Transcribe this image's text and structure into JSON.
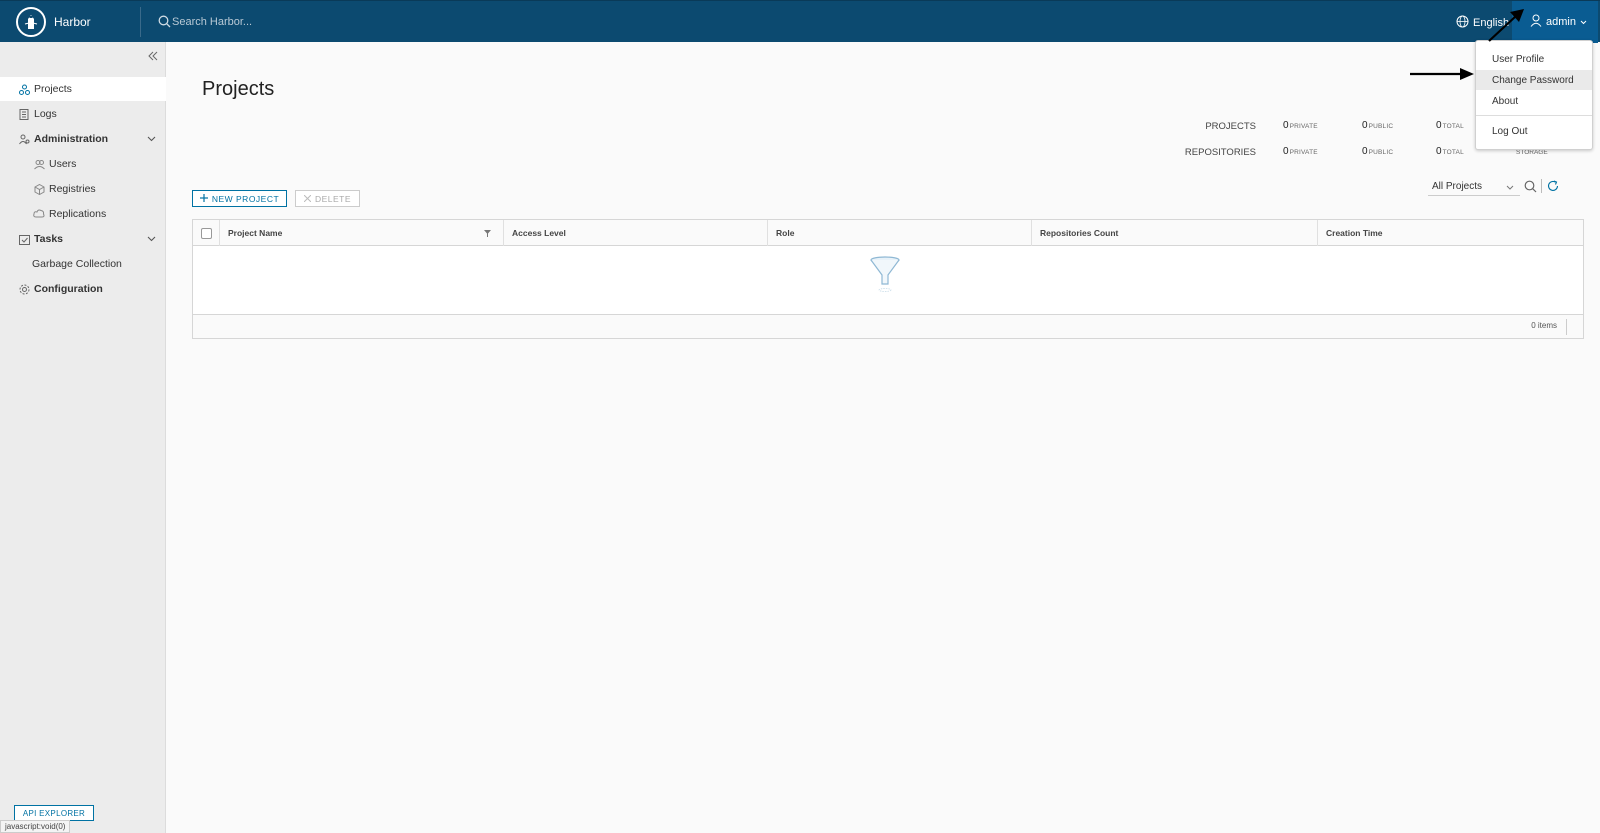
{
  "header": {
    "brand": "Harbor",
    "search_placeholder": "Search Harbor...",
    "language": "English",
    "user": "admin"
  },
  "sidebar": {
    "items": [
      {
        "label": "Projects",
        "icon": "projects-icon"
      },
      {
        "label": "Logs",
        "icon": "logs-icon"
      },
      {
        "label": "Administration",
        "icon": "administration-icon"
      },
      {
        "label": "Users",
        "icon": "users-icon"
      },
      {
        "label": "Registries",
        "icon": "registries-icon"
      },
      {
        "label": "Replications",
        "icon": "replications-icon"
      },
      {
        "label": "Tasks",
        "icon": "tasks-icon"
      },
      {
        "label": "Garbage Collection"
      },
      {
        "label": "Configuration",
        "icon": "configuration-icon"
      }
    ],
    "api_explorer": "API EXPLORER"
  },
  "status_bar": "javascript:void(0)",
  "main": {
    "title": "Projects",
    "stats": {
      "projects_label": "PROJECTS",
      "repositories_label": "REPOSITORIES",
      "projects": {
        "private": "0",
        "public": "0",
        "total": "0"
      },
      "repositories": {
        "private": "0",
        "public": "0",
        "total": "0"
      },
      "private_label": "PRIVATE",
      "public_label": "PUBLIC",
      "total_label": "TOTAL",
      "storage_label": "STORAGE"
    },
    "new_project": "NEW PROJECT",
    "delete": "DELETE",
    "filter_value": "All Projects",
    "columns": [
      "Project Name",
      "Access Level",
      "Role",
      "Repositories Count",
      "Creation Time"
    ],
    "items_count": "0 items"
  },
  "user_menu": {
    "items": [
      "User Profile",
      "Change Password",
      "About",
      "Log Out"
    ]
  },
  "colors": {
    "header": "#0c4a70",
    "accent": "#0072a3"
  }
}
